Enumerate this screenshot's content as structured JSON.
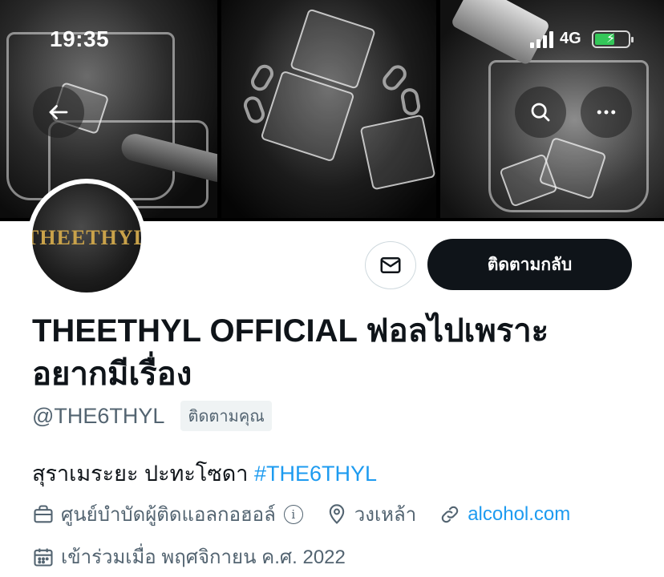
{
  "status_bar": {
    "time": "19:35",
    "network": "4G"
  },
  "profile": {
    "avatar_text": "THEETHYL",
    "name_line1": "THEETHYL OFFICIAL ฟอลไปเพราะ",
    "name_line2": "อยากมีเรื่อง",
    "handle": "@THE6THYL",
    "follows_you_badge": "ติดตามคุณ",
    "follow_back_label": "ติดตามกลับ",
    "bio_text": "สุราเมระยะ ปะทะโซดา ",
    "bio_hashtag": "#THE6THYL",
    "category": "ศูนย์บำบัดผู้ติดแอลกอฮอล์",
    "info_glyph": "i",
    "location": "วงเหล้า",
    "website": "alcohol.com",
    "joined": "เข้าร่วมเมื่อ พฤศจิกายน ค.ศ. 2022"
  },
  "icons": {
    "back": "arrow-left-icon",
    "search": "search-icon",
    "more": "more-horizontal-icon",
    "message": "envelope-icon",
    "category": "briefcase-icon",
    "location": "location-pin-icon",
    "link": "link-icon",
    "calendar": "calendar-icon"
  },
  "colors": {
    "accent": "#1d9bf0",
    "primary_button": "#0f1419",
    "secondary_text": "#536471",
    "battery": "#34c759"
  }
}
